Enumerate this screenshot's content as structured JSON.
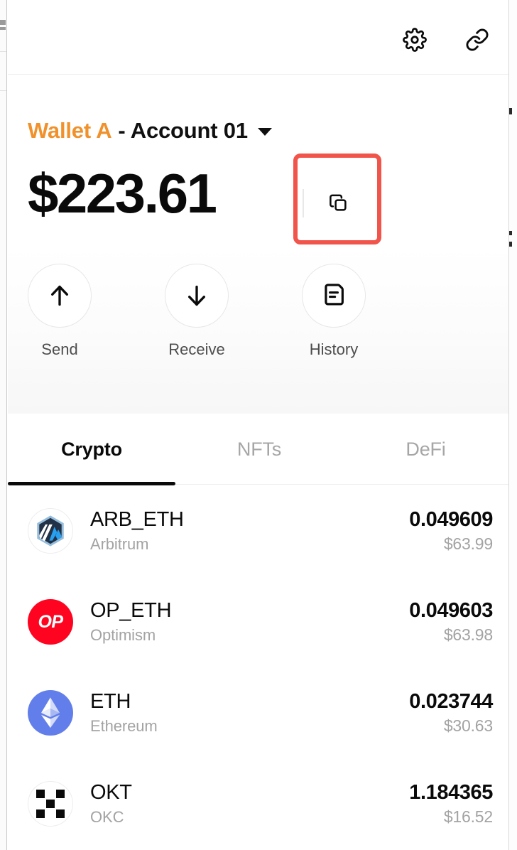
{
  "topbar": {
    "settings_icon": "gear-icon",
    "connection_icon": "link-icon"
  },
  "account": {
    "wallet_label": "Wallet A",
    "account_label": "- Account 01",
    "dropdown_icon": "chevron-down-icon",
    "copy_icon": "copy-icon",
    "highlight_color": "#f0544a",
    "wallet_color": "#f0912c",
    "balance": "$223.61"
  },
  "actions": [
    {
      "label": "Send",
      "icon": "arrow-up-icon"
    },
    {
      "label": "Receive",
      "icon": "arrow-down-icon"
    },
    {
      "label": "History",
      "icon": "document-icon"
    }
  ],
  "tabs": [
    {
      "label": "Crypto",
      "active": true
    },
    {
      "label": "NFTs",
      "active": false
    },
    {
      "label": "DeFi",
      "active": false
    }
  ],
  "tokens": [
    {
      "symbol": "ARB_ETH",
      "network": "Arbitrum",
      "amount": "0.049609",
      "fiat": "$63.99",
      "logo": "arbitrum-logo"
    },
    {
      "symbol": "OP_ETH",
      "network": "Optimism",
      "amount": "0.049603",
      "fiat": "$63.98",
      "logo": "optimism-logo",
      "logo_text": "OP"
    },
    {
      "symbol": "ETH",
      "network": "Ethereum",
      "amount": "0.023744",
      "fiat": "$30.63",
      "logo": "ethereum-logo"
    },
    {
      "symbol": "OKT",
      "network": "OKC",
      "amount": "1.184365",
      "fiat": "$16.52",
      "logo": "okx-logo"
    }
  ]
}
